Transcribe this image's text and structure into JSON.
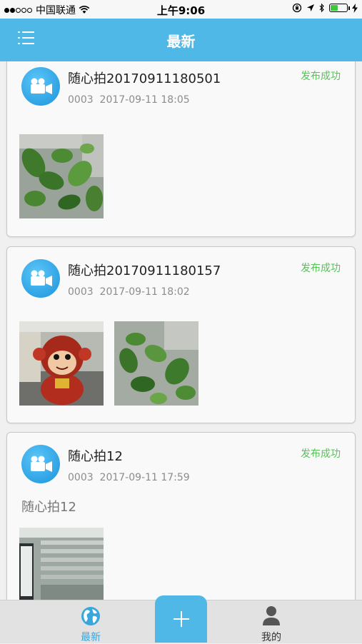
{
  "status_bar": {
    "carrier": "中国联通",
    "time": "上午9:06"
  },
  "nav": {
    "title": "最新"
  },
  "posts": [
    {
      "title": "随心拍20170911180501",
      "status": "发布成功",
      "id": "0003",
      "datetime": "2017-09-11 18:05",
      "photos": [
        "plant"
      ]
    },
    {
      "title": "随心拍20170911180157",
      "status": "发布成功",
      "id": "0003",
      "datetime": "2017-09-11 18:02",
      "photos": [
        "monkey-toy",
        "plant"
      ]
    },
    {
      "title": "随心拍12",
      "status": "发布成功",
      "id": "0003",
      "datetime": "2017-09-11 17:59",
      "description": "随心拍12",
      "photos": [
        "office"
      ]
    }
  ],
  "tabs": [
    {
      "label": "最新",
      "icon": "globe-icon",
      "active": true
    },
    {
      "label": "我的",
      "icon": "user-icon",
      "active": false
    }
  ],
  "colors": {
    "primary": "#4fb8e6",
    "success": "#5bbf5b",
    "active_tab": "#3aa7dc"
  }
}
